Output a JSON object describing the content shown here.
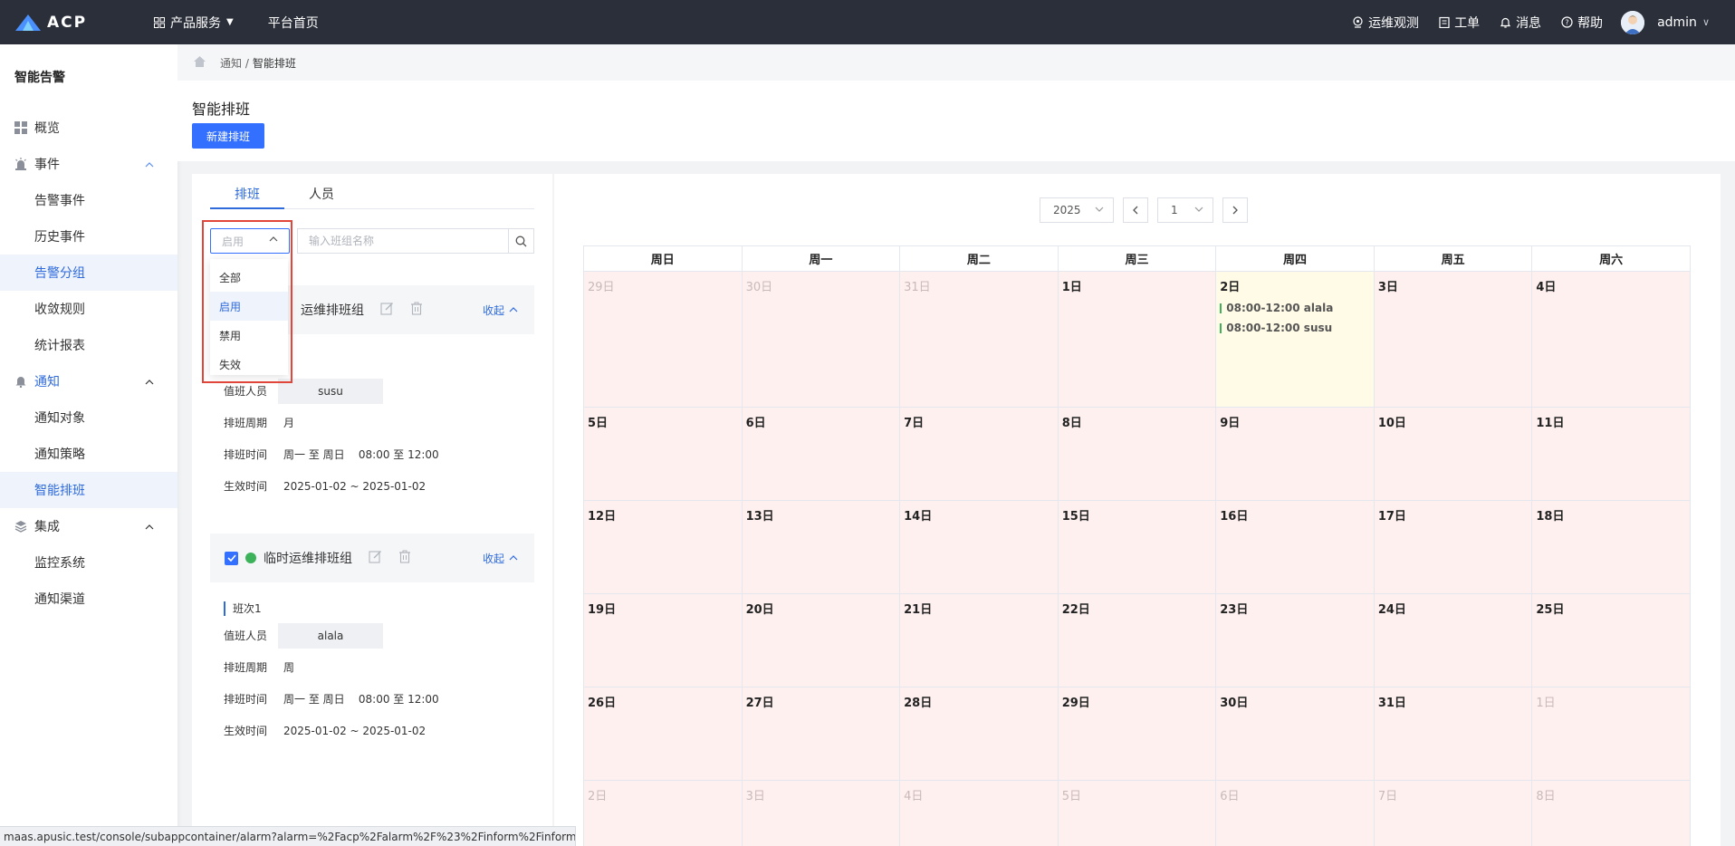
{
  "topbar": {
    "logo_text": "ACP",
    "product_menu": "产品服务",
    "home_link": "平台首页",
    "ops_observe": "运维观测",
    "work_order": "工单",
    "messages": "消息",
    "help": "帮助",
    "user": "admin"
  },
  "sidebar": {
    "title": "智能告警",
    "overview": "概览",
    "events": {
      "label": "事件",
      "items": [
        "告警事件",
        "历史事件",
        "告警分组",
        "收敛规则",
        "统计报表"
      ]
    },
    "notify": {
      "label": "通知",
      "items": [
        "通知对象",
        "通知策略",
        "智能排班"
      ]
    },
    "integrate": {
      "label": "集成",
      "items": [
        "监控系统",
        "通知渠道"
      ]
    }
  },
  "breadcrumb": {
    "parent": "通知 /",
    "current": "智能排班"
  },
  "header": {
    "title": "智能排班",
    "new_button": "新建排班"
  },
  "left_panel": {
    "tabs": [
      "排班",
      "人员"
    ],
    "status_filter": "启用",
    "search_placeholder": "输入班组名称",
    "dropdown_options": [
      "全部",
      "启用",
      "禁用",
      "失效"
    ],
    "groups": [
      {
        "name": "运维排班组",
        "collapse": "收起",
        "person_label": "值班人员",
        "person": "susu",
        "cycle_label": "排班周期",
        "cycle": "月",
        "time_label": "排班时间",
        "time": "周一 至 周日    08:00 至 12:00",
        "effective_label": "生效时间",
        "effective": "2025-01-02 ~ 2025-01-02"
      },
      {
        "name": "临时运维排班组",
        "collapse": "收起",
        "shift": "班次1",
        "person_label": "值班人员",
        "person": "alala",
        "cycle_label": "排班周期",
        "cycle": "周",
        "time_label": "排班时间",
        "time": "周一 至 周日    08:00 至 12:00",
        "effective_label": "生效时间",
        "effective": "2025-01-02 ~ 2025-01-02"
      }
    ]
  },
  "calendar": {
    "year": "2025",
    "month": "1",
    "weekdays": [
      "周日",
      "周一",
      "周二",
      "周三",
      "周四",
      "周五",
      "周六"
    ],
    "weeks": [
      [
        "29日",
        "30日",
        "31日",
        "1日",
        "2日",
        "3日",
        "4日"
      ],
      [
        "5日",
        "6日",
        "7日",
        "8日",
        "9日",
        "10日",
        "11日"
      ],
      [
        "12日",
        "13日",
        "14日",
        "15日",
        "16日",
        "17日",
        "18日"
      ],
      [
        "19日",
        "20日",
        "21日",
        "22日",
        "23日",
        "24日",
        "25日"
      ],
      [
        "26日",
        "27日",
        "28日",
        "29日",
        "30日",
        "31日",
        "1日"
      ],
      [
        "2日",
        "3日",
        "4日",
        "5日",
        "6日",
        "7日",
        "8日"
      ]
    ],
    "events_jan2": [
      "08:00-12:00 alala",
      "08:00-12:00 susu"
    ]
  },
  "status_url": "maas.apusic.test/console/subappcontainer/alarm?alarm=%2Facp%2Falarm%2F%23%2Finform%2FinformSc...",
  "colors": {
    "accent": "#3370ff",
    "topbar": "#2b2f3a",
    "enabled_dot": "#3cb25a",
    "calendar_cell": "#fff0f0",
    "today_cell": "#fffbe6",
    "highlight_outline": "#e0463a"
  }
}
